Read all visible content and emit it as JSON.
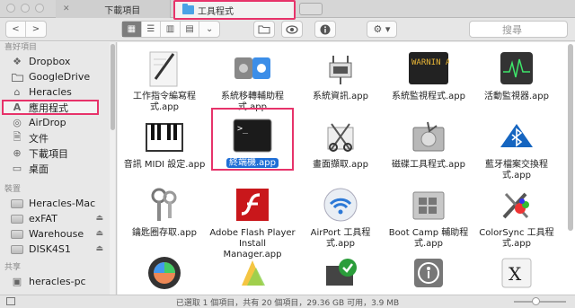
{
  "tabs": [
    {
      "label": "下載項目",
      "icon": "folder-icon"
    },
    {
      "label": "工具程式",
      "icon": "folder-icon"
    }
  ],
  "toolbar": {
    "search_placeholder": "搜尋"
  },
  "sidebar": {
    "favorites_header": "喜好項目",
    "favorites": [
      {
        "label": "Dropbox",
        "icon": "dropbox-icon"
      },
      {
        "label": "GoogleDrive",
        "icon": "folder-icon"
      },
      {
        "label": "Heracles",
        "icon": "home-icon"
      },
      {
        "label": "應用程式",
        "icon": "applications-icon"
      },
      {
        "label": "AirDrop",
        "icon": "airdrop-icon"
      },
      {
        "label": "文件",
        "icon": "document-icon"
      },
      {
        "label": "下載項目",
        "icon": "download-icon"
      },
      {
        "label": "桌面",
        "icon": "desktop-icon"
      }
    ],
    "devices_header": "裝置",
    "devices": [
      {
        "label": "Heracles-Mac",
        "icon": "computer-icon"
      },
      {
        "label": "exFAT",
        "icon": "drive-icon"
      },
      {
        "label": "Warehouse",
        "icon": "drive-icon"
      },
      {
        "label": "DISK4S1",
        "icon": "drive-icon"
      }
    ],
    "shared_header": "共享",
    "shared": [
      {
        "label": "heracles-pc",
        "icon": "pc-icon"
      }
    ]
  },
  "apps": [
    {
      "label": "工作指令編寫程式.app",
      "icon": "script-editor-icon"
    },
    {
      "label": "系統移轉輔助程式.app",
      "icon": "migration-assistant-icon"
    },
    {
      "label": "系統資訊.app",
      "icon": "system-info-icon"
    },
    {
      "label": "系統監視程式.app",
      "icon": "console-icon",
      "screen_text": "WARNIN AY 7:36"
    },
    {
      "label": "活動監視器.app",
      "icon": "activity-monitor-icon"
    },
    {
      "label": "音訊 MIDI 設定.app",
      "icon": "midi-keyboard-icon"
    },
    {
      "label": "終端機.app",
      "icon": "terminal-icon"
    },
    {
      "label": "畫面擷取.app",
      "icon": "grab-icon"
    },
    {
      "label": "磁碟工具程式.app",
      "icon": "disk-utility-icon"
    },
    {
      "label": "藍牙檔案交換程式.app",
      "icon": "bluetooth-icon"
    },
    {
      "label": "鑰匙圈存取.app",
      "icon": "keychain-icon"
    },
    {
      "label": "Adobe Flash Player Install Manager.app",
      "icon": "flash-icon"
    },
    {
      "label": "AirPort 工具程式.app",
      "icon": "airport-icon"
    },
    {
      "label": "Boot Camp 輔助程式.app",
      "icon": "bootcamp-icon"
    },
    {
      "label": "ColorSync 工具程式.app",
      "icon": "colorsync-icon"
    },
    {
      "label": "",
      "icon": "digital-color-meter-icon"
    },
    {
      "label": "",
      "icon": "grapher-icon"
    },
    {
      "label": "",
      "icon": "java-preferences-icon"
    },
    {
      "label": "",
      "icon": "voiceover-icon"
    },
    {
      "label": "",
      "icon": "x11-icon"
    }
  ],
  "status": {
    "text": "已選取 1 個項目，共有 20 個項目，29.36 GB 可用，3.9 MB"
  },
  "colors": {
    "highlight": "#e7336a",
    "selection": "#1f6fd6",
    "folder": "#4aa2e6"
  }
}
